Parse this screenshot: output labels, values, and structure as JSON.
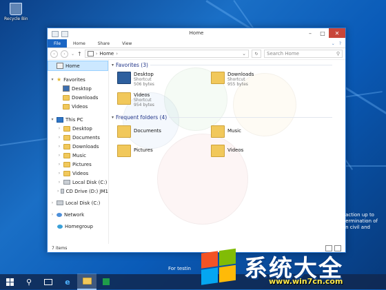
{
  "desktop": {
    "recycle_bin_label": "Recycle Bin",
    "notice_lines": [
      "action up to",
      "ermination of",
      "n civil and"
    ],
    "test_text": "For testin"
  },
  "window": {
    "title": "Home",
    "minimize": "–",
    "maximize": "□",
    "close": "✕"
  },
  "ribbon": {
    "tabs": [
      "File",
      "Home",
      "Share",
      "View"
    ],
    "expand": "⌄",
    "help": "?"
  },
  "navbar": {
    "back": "‹",
    "forward": "›",
    "recent": "⌄",
    "up": "↑",
    "path_root": "›",
    "path": "Home",
    "path_sep": "›",
    "refresh": "↻",
    "search_placeholder": "Search Home",
    "search_icon": "⚲"
  },
  "nav_pane": {
    "items": [
      {
        "label": "Home",
        "arrow": "",
        "icon": "home"
      },
      {
        "label": "Favorites",
        "arrow": "▾",
        "icon": "star"
      },
      {
        "label": "Desktop",
        "arrow": "",
        "icon": "desktop"
      },
      {
        "label": "Downloads",
        "arrow": "",
        "icon": "folder"
      },
      {
        "label": "Videos",
        "arrow": "",
        "icon": "folder"
      },
      {
        "label": "This PC",
        "arrow": "▾",
        "icon": "pc"
      },
      {
        "label": "Desktop",
        "arrow": "›",
        "icon": "folder"
      },
      {
        "label": "Documents",
        "arrow": "›",
        "icon": "folder"
      },
      {
        "label": "Downloads",
        "arrow": "›",
        "icon": "folder"
      },
      {
        "label": "Music",
        "arrow": "›",
        "icon": "folder"
      },
      {
        "label": "Pictures",
        "arrow": "›",
        "icon": "folder"
      },
      {
        "label": "Videos",
        "arrow": "›",
        "icon": "folder"
      },
      {
        "label": "Local Disk (C:)",
        "arrow": "›",
        "icon": "disk"
      },
      {
        "label": "CD Drive (D:) JM1",
        "arrow": "›",
        "icon": "disk"
      },
      {
        "label": "Local Disk (C:)",
        "arrow": "›",
        "icon": "disk"
      },
      {
        "label": "Network",
        "arrow": "›",
        "icon": "network"
      },
      {
        "label": "Homegroup",
        "arrow": "",
        "icon": "homegroup"
      }
    ]
  },
  "main": {
    "favorites_header": "Favorites (3)",
    "frequent_header": "Frequent folders (4)",
    "favorites": [
      {
        "name": "Desktop",
        "type": "Shortcut",
        "size": "506 bytes"
      },
      {
        "name": "Downloads",
        "type": "Shortcut",
        "size": "955 bytes"
      },
      {
        "name": "Videos",
        "type": "Shortcut",
        "size": "954 bytes"
      }
    ],
    "frequent": [
      {
        "name": "Documents"
      },
      {
        "name": "Music"
      },
      {
        "name": "Pictures"
      },
      {
        "name": "Videos"
      }
    ]
  },
  "statusbar": {
    "item_count": "7 items"
  },
  "watermark": {
    "title": "系统大全",
    "url": "www.win7cn.com"
  },
  "colors": {
    "accent": "#1a66c4",
    "close_red": "#c8463a",
    "desktop_blue": "#1a6fc6"
  }
}
